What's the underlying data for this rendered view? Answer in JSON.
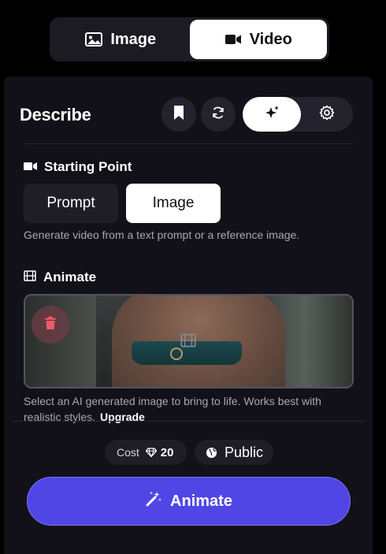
{
  "mode_switch": {
    "image_label": "Image",
    "video_label": "Video",
    "active": "Video"
  },
  "panel": {
    "title": "Describe",
    "starting_point": {
      "title": "Starting Point",
      "options": [
        "Prompt",
        "Image"
      ],
      "selected": "Image",
      "help": "Generate video from a text prompt or a reference image."
    },
    "animate": {
      "title": "Animate",
      "help": "Select an AI generated image to bring to life. Works best with realistic styles.",
      "upgrade_label": "Upgrade"
    },
    "footer": {
      "cost_label": "Cost",
      "cost_value": "20",
      "visibility_label": "Public",
      "cta_label": "Animate"
    }
  },
  "colors": {
    "background": "#000000",
    "panel": "#121119",
    "accent": "#5046e5",
    "chip": "#1f1e27"
  },
  "icons": {
    "image_tab": "image-icon",
    "video_tab": "video-camera-icon",
    "bookmark": "bookmark-icon",
    "refresh": "refresh-icon",
    "magic": "sparkles-icon",
    "settings": "gear-icon",
    "starting_point": "video-camera-icon",
    "animate": "film-icon",
    "delete": "trash-icon",
    "cost": "gem-icon",
    "visibility": "globe-icon",
    "cta": "magic-wand-icon"
  }
}
